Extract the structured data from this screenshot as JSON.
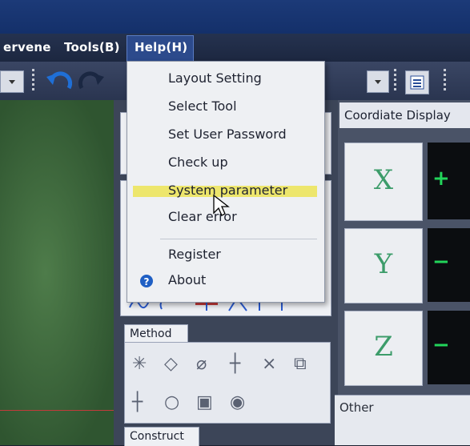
{
  "menu": {
    "items": [
      "ervene",
      "Tools(B)",
      "Help(H)"
    ]
  },
  "help_menu": {
    "items": [
      "Layout Setting",
      "Select Tool",
      "Set User Password",
      "Check up",
      "System parameter",
      "Clear error"
    ],
    "items2": [
      "Register",
      "About"
    ],
    "highlighted": "System parameter"
  },
  "tabs": {
    "method": "Method",
    "construct": "Construct"
  },
  "coordinate": {
    "title": "Coordiate Display",
    "axes": [
      "X",
      "Y",
      "Z"
    ],
    "signs": [
      "+",
      "−",
      "−"
    ]
  },
  "other": {
    "label": "Other"
  },
  "icons": {
    "about": "question-circle-icon",
    "cursor": "mouse-pointer-icon"
  },
  "colors": {
    "menu_bg": "#25324f",
    "highlight": "#ece44a",
    "axis_green": "#3c9c6a",
    "value_green": "#22d45a"
  }
}
